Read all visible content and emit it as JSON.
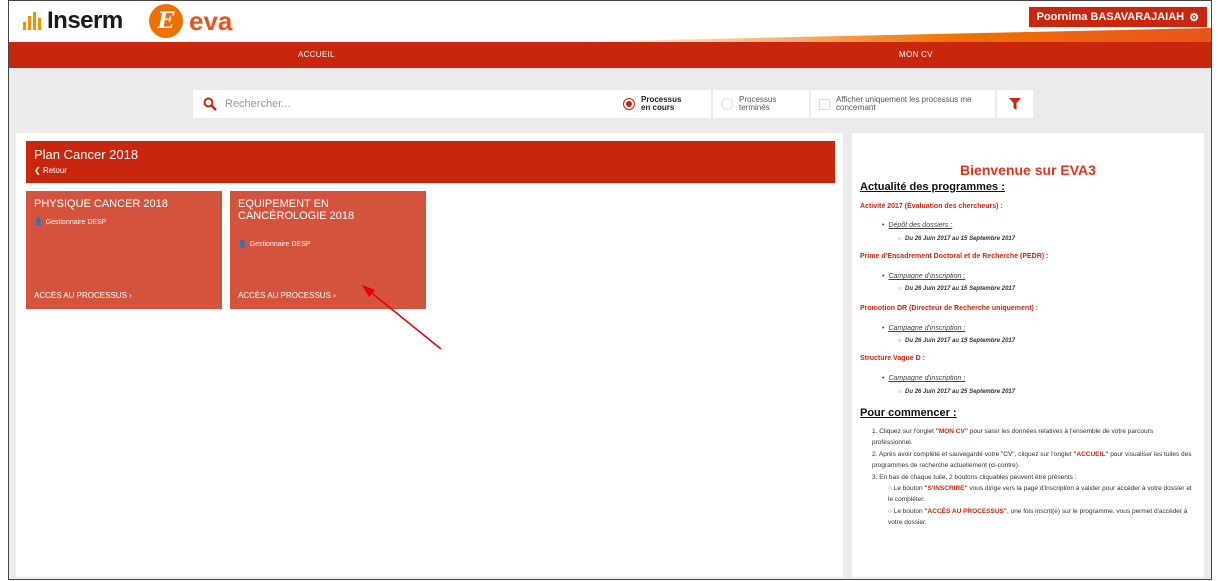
{
  "header": {
    "logo_inserm": "Inserm",
    "logo_eva_letter": "E",
    "logo_eva": "eva",
    "user_name": "Poornima BASAVARAJAIAH"
  },
  "nav": {
    "items": [
      {
        "label": "ACCUEIL"
      },
      {
        "label": "MON CV"
      }
    ]
  },
  "filters": {
    "search_placeholder": "Rechercher...",
    "opt_current": "Processus en cours",
    "opt_finished": "Processus terminés",
    "opt_mine": "Afficher uniquement les processus me concernant"
  },
  "program": {
    "title": "Plan Cancer 2018",
    "back": "Retour",
    "tiles": [
      {
        "title": "PHYSIQUE CANCER 2018",
        "role": "Gestionnaire DESP",
        "link": "ACCÈS AU PROCESSUS ›"
      },
      {
        "title": "EQUIPEMENT EN CANCÉROLOGIE 2018",
        "role": "Gestionnaire DESP",
        "link": "ACCÈS AU PROCESSUS ›"
      }
    ]
  },
  "sidebar": {
    "welcome": "Bienvenue sur EVA3",
    "news_title": "Actualité des programmes :",
    "programs": [
      {
        "name": "Activité 2017 (Évaluation des chercheurs) :",
        "item": "Dépôt des dossiers :",
        "dates": "Du 26 Juin 2017 au 15 Septembre 2017"
      },
      {
        "name": "Prime d'Encadrement Doctoral et de Recherche (PEDR) :",
        "item": "Campagne d'inscription :",
        "dates": "Du 26 Juin 2017 au 15 Septembre 2017"
      },
      {
        "name": "Promotion DR (Directeur de Recherche uniquement) :",
        "item": "Campagne d'inscription :",
        "dates": "Du 26 Juin 2017 au 15 Septembre 2017"
      },
      {
        "name": "Structure Vague D :",
        "item": "Campagne d'inscription :",
        "dates": "Du 26 Juin 2017 au 25 Septembre 2017"
      }
    ],
    "start_title": "Pour commencer :",
    "step1_a": "1. Cliquez sur l'onglet ",
    "step1_hl": "\"MON CV\"",
    "step1_b": " pour saisir les données relatives à l'ensemble de votre parcours professionnel.",
    "step2_a": "2. Après avoir complété et sauvegardé votre \"CV\", cliquez sur l'onglet ",
    "step2_hl": "\"ACCUEIL\"",
    "step2_b": " pour visualiser les tuiles des programmes de recherche actuellement (ci-contre).",
    "step3": "3. En bas de chaque tuile, 2 boutons cliquables peuvent être présents :",
    "sub1_a": "○ Le bouton ",
    "sub1_hl": "\"S'INSCRIRE\"",
    "sub1_b": " vous dirige vers la page d'inscription à valider pour accéder à votre dossier et le compléter.",
    "sub2_a": "○ Le bouton ",
    "sub2_hl": "\"ACCÈS AU PROCESSUS\"",
    "sub2_b": ", une fois inscrit(e) sur le programme, vous permet d'accéder à votre dossier."
  },
  "colors": {
    "brand_red": "#c9260e",
    "tile": "#d3533c",
    "orange": "#ee7203",
    "annotation_arrow": "#e60000"
  }
}
